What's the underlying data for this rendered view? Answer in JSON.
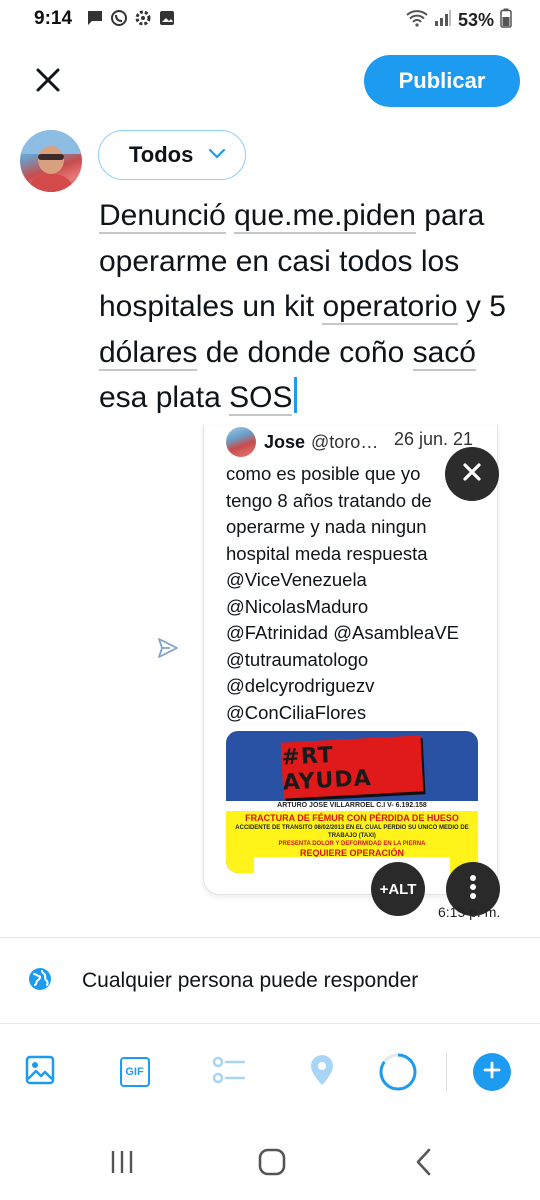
{
  "status_bar": {
    "time": "9:14",
    "battery": "53%",
    "left_icons": [
      "message-icon",
      "whatsapp-icon",
      "settings-icon",
      "gallery-icon"
    ],
    "right_icons": [
      "wifi-icon",
      "signal-icon",
      "battery-icon"
    ]
  },
  "header": {
    "close_icon": "close-icon",
    "publish_label": "Publicar",
    "accent_color": "#1d9bf0"
  },
  "audience": {
    "label": "Todos"
  },
  "compose": {
    "words": [
      {
        "text": "Denunció",
        "underline": true
      },
      {
        "text": " ",
        "underline": false
      },
      {
        "text": "que.me.piden",
        "underline": true
      },
      {
        "text": " para operarme en casi todos los hospitales un kit ",
        "underline": false
      },
      {
        "text": "operatorio",
        "underline": true
      },
      {
        "text": " y 5 ",
        "underline": false
      },
      {
        "text": "dólares",
        "underline": true
      },
      {
        "text": " de donde coño ",
        "underline": false
      },
      {
        "text": "sacó",
        "underline": true
      },
      {
        "text": " esa plata ",
        "underline": false
      },
      {
        "text": "SOS",
        "underline": true
      }
    ]
  },
  "quote": {
    "name": "Jose",
    "handle": "@toro…",
    "date": "26 jun. 21",
    "lines": [
      "como es posible que yo",
      "tengo 8 años tratando de",
      "operarme y nada ningun",
      "hospital meda respuesta",
      "@ViceVenezuela",
      "@NicolasMaduro",
      "@FAtrinidad @AsambleaVE",
      "@tutraumatologo",
      "@delcyrodriguezv",
      "@ConCiliaFlores"
    ],
    "image": {
      "banner": "#RT AYUDA",
      "name_line": "ARTURO JOSE VILLARROEL C.I V- 6.192.158",
      "line1": "FRACTURA DE FÉMUR CON PÉRDIDA DE HUESO",
      "line2": "ACCIDENTE DE TRANSITO 08/02/2013 EN EL CUAL PERDIO SU UNICO MEDIO DE TRABAJO (TAXI)",
      "line3": "PRESENTA DOLOR Y DEFORMIDAD EN LA PIERNA",
      "line4": "REQUIERE OPERACIÓN"
    },
    "alt_label": "+ALT",
    "time": "6:15 p. m."
  },
  "reply_setting": {
    "label": "Cualquier persona puede responder"
  },
  "toolbar": {
    "items": [
      "image-icon",
      "gif-icon",
      "poll-icon",
      "location-icon",
      "progress-ring-icon",
      "add-icon"
    ],
    "gif_label": "GIF",
    "character_progress": 0.85
  },
  "nav_bar": {
    "items": [
      "recents-icon",
      "home-icon",
      "back-icon"
    ]
  }
}
